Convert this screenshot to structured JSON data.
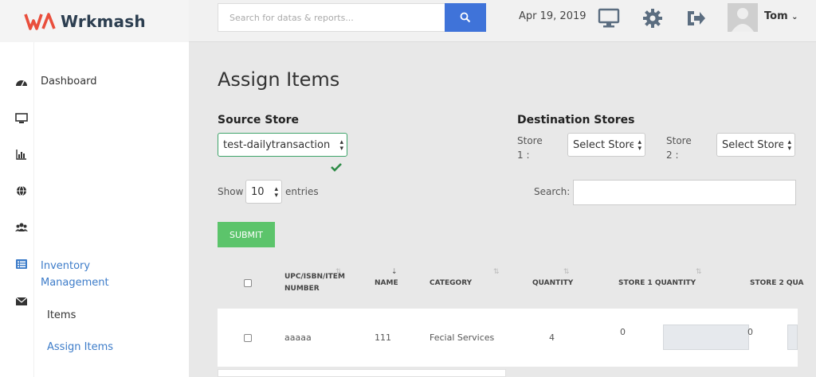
{
  "app": {
    "brand": "Wrkmash",
    "brand_color": "#e94e3c",
    "accent": "#3f73d9"
  },
  "header": {
    "search_placeholder": "Search for datas & reports...",
    "date": "Apr 19, 2019",
    "user": "Tom",
    "icons": [
      "monitor-icon",
      "gear-icon",
      "logout-icon"
    ]
  },
  "sidebar": {
    "items": [
      {
        "icon": "dashboard-icon",
        "label": "Dashboard"
      },
      {
        "icon": "monitor-icon",
        "label": ""
      },
      {
        "icon": "bar-chart-icon",
        "label": ""
      },
      {
        "icon": "globe-icon",
        "label": ""
      },
      {
        "icon": "users-icon",
        "label": ""
      },
      {
        "icon": "list-icon",
        "label": "Inventory Management"
      },
      {
        "icon": "envelope-icon",
        "label": ""
      }
    ],
    "inventory_label_1": "Inventory",
    "inventory_label_2": "Management",
    "sub_items": [
      "Items",
      "Assign Items"
    ]
  },
  "main": {
    "title": "Assign Items",
    "source": {
      "heading": "Source Store",
      "value": "test-dailytransaction"
    },
    "destination": {
      "heading": "Destination Stores",
      "store1_label": "Store",
      "store1_num": "1 :",
      "store1_value": "Select Store",
      "store2_label": "Store",
      "store2_num": "2 :",
      "store2_value": "Select Store"
    },
    "show_label": "Show",
    "show_value": "10",
    "entries_label": "entries",
    "search_label": "Search:",
    "submit_label": "SUBMIT",
    "table": {
      "headers": [
        "UPC/ISBN/ITEM",
        "NUMBER",
        "NAME",
        "CATEGORY",
        "QUANTITY",
        "STORE 1 QUANTITY",
        "STORE 2 QUA"
      ],
      "rows": [
        {
          "upc": "aaaaa",
          "name": "111",
          "category": "Fecial Services",
          "quantity": "4",
          "store1": "0",
          "store2": "0"
        }
      ]
    }
  }
}
